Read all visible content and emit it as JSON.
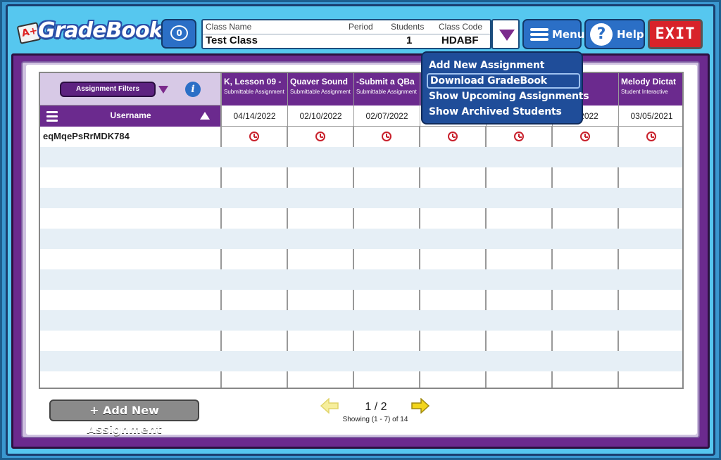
{
  "app": {
    "logo_badge": "A+",
    "logo_text": "GradeBook"
  },
  "chat": {
    "icon": "chat-bubble-icon",
    "count": "0"
  },
  "class_info": {
    "labels": {
      "name": "Class Name",
      "period": "Period",
      "students": "Students",
      "code": "Class Code"
    },
    "values": {
      "name": "Test Class",
      "period": "",
      "students": "1",
      "code": "HDABF"
    }
  },
  "toolbar": {
    "menu_label": "Menu",
    "help_label": "Help",
    "exit_label": "EXIT"
  },
  "filters": {
    "button_label": "Assignment Filters",
    "info_glyph": "i"
  },
  "table": {
    "username_header": "Username",
    "columns": [
      {
        "title": "K, Lesson 09 -",
        "sub": "Submittable Assignment",
        "date": "04/14/2022"
      },
      {
        "title": "Quaver Sound",
        "sub": "Submittable Assignment",
        "date": "02/10/2022"
      },
      {
        "title": "-Submit a QBa",
        "sub": "Submittable Assignment",
        "date": "02/07/2022"
      },
      {
        "title": "",
        "sub": "",
        "date": ""
      },
      {
        "title": "",
        "sub": "",
        "date": ""
      },
      {
        "title": "n",
        "sub": "le nt",
        "date": "5/2022"
      },
      {
        "title": "Melody Dictat",
        "sub": "Student Interactive",
        "date": "03/05/2021"
      }
    ],
    "students": [
      "eqMqePsRrMDK784"
    ]
  },
  "footer": {
    "add_label": "+ Add New Assignment",
    "page": "1 / 2",
    "showing": "Showing (1 - 7) of 14"
  },
  "menu_popup": {
    "items": [
      {
        "label": "Add New Assignment"
      },
      {
        "label": "Download GradeBook"
      },
      {
        "label": "Show Upcoming Assignments"
      },
      {
        "label": "Show Archived Students"
      }
    ]
  },
  "colors": {
    "purple": "#6b2a8e",
    "sky": "#56c7ef",
    "menu_blue": "#1f4d99",
    "exit_red": "#d8232a",
    "clock_red": "#c8212c"
  }
}
